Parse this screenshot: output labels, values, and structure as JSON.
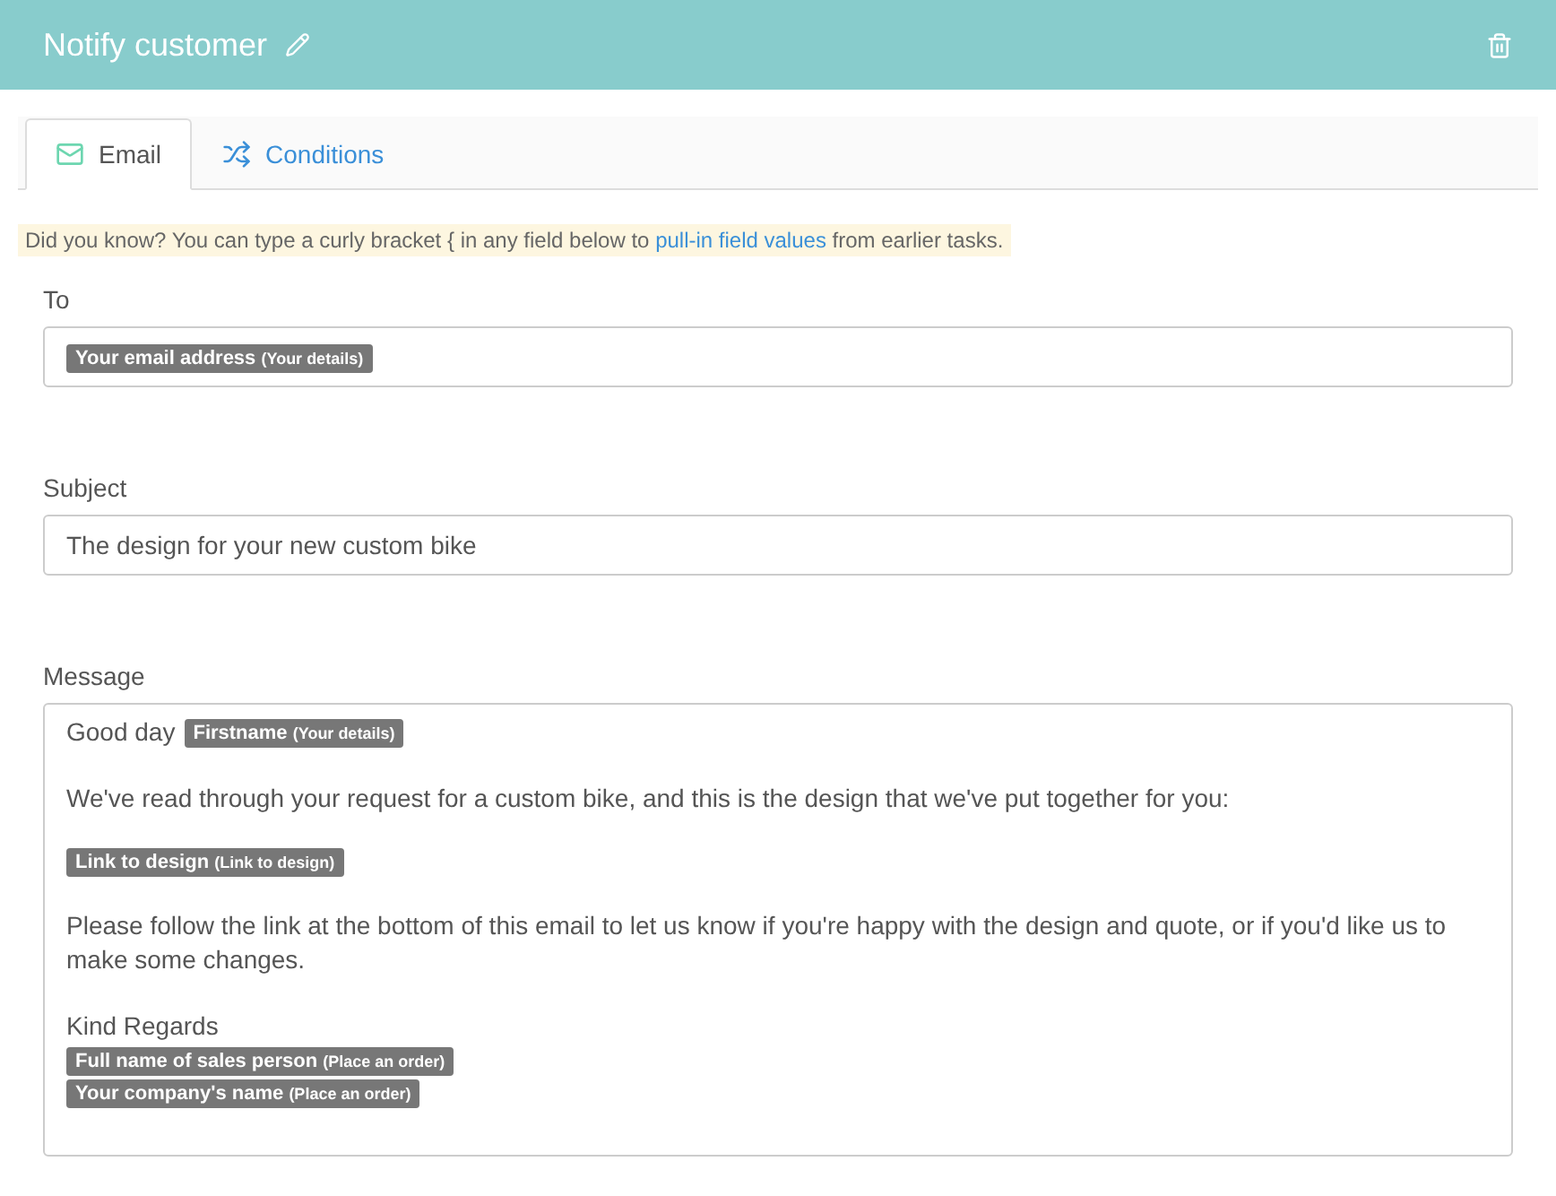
{
  "header": {
    "title": "Notify customer"
  },
  "tabs": [
    {
      "label": "Email",
      "kind": "email",
      "selected": true
    },
    {
      "label": "Conditions",
      "kind": "conditions",
      "selected": false
    }
  ],
  "tip": {
    "before": "Did you know? You can type a curly bracket { in any field below to",
    "link": "pull-in field values",
    "after": "from earlier tasks."
  },
  "to": {
    "label": "To",
    "tokens": [
      {
        "label": "Your email address",
        "source": "(Your details)"
      }
    ]
  },
  "subject": {
    "label": "Subject",
    "value": "The design for your new custom bike"
  },
  "message": {
    "label": "Message",
    "paragraphs": [
      [
        [
          {
            "kind": "text",
            "text": "Good day"
          },
          {
            "kind": "token",
            "label": "Firstname",
            "source": "(Your details)"
          }
        ]
      ],
      [
        [
          {
            "kind": "text",
            "text": "We've read through your request for a custom bike, and this is the design that we've put together for you:"
          }
        ]
      ],
      [
        [
          {
            "kind": "token",
            "label": "Link to design",
            "source": "(Link to design)"
          }
        ]
      ],
      [
        [
          {
            "kind": "text",
            "text": "Please follow the link at the bottom of this email to let us know if you're happy with the design and quote, or if you'd like us to make some changes."
          }
        ]
      ],
      [
        [
          {
            "kind": "text",
            "text": "Kind Regards"
          }
        ],
        [
          {
            "kind": "token",
            "label": "Full name of sales person",
            "source": "(Place an order)"
          }
        ],
        [
          {
            "kind": "token",
            "label": "Your company's name",
            "source": "(Place an order)"
          }
        ]
      ]
    ]
  }
}
